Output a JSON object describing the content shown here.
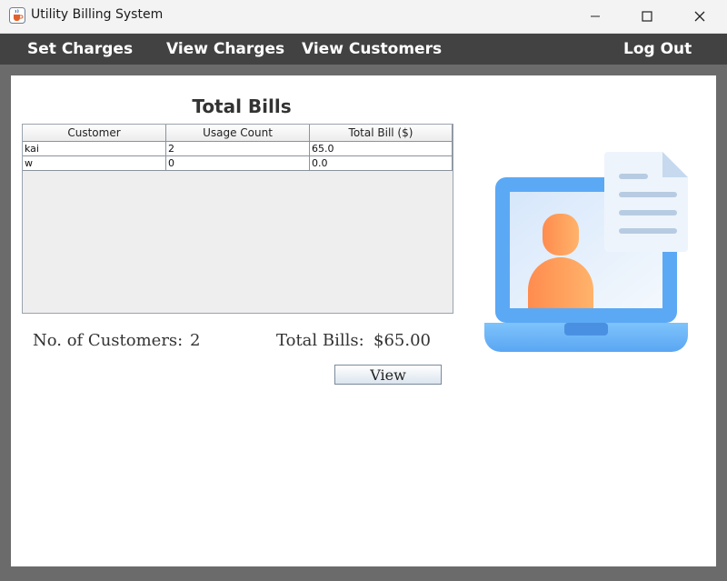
{
  "window": {
    "title": "Utility Billing System",
    "icon": "java-cup-icon",
    "controls": [
      "minimize-icon",
      "maximize-icon",
      "close-icon"
    ]
  },
  "menu": {
    "set_charges": "Set Charges",
    "view_charges": "View Charges",
    "view_customers": "View Customers",
    "log_out": "Log Out"
  },
  "main": {
    "heading": "Total Bills",
    "table": {
      "columns": [
        "Customer",
        "Usage Count",
        "Total Bill ($)"
      ],
      "rows": [
        [
          "kai",
          "2",
          "65.0"
        ],
        [
          "w",
          "0",
          "0.0"
        ]
      ]
    },
    "summary": {
      "customers_label": "No. of Customers:",
      "customers_value": "2",
      "bills_label": "Total Bills:",
      "bills_value": "$65.00"
    },
    "view_button": "View",
    "illustration": "laptop-user-document-illustration"
  },
  "colors": {
    "menubar": "#424242",
    "frame": "#6b6b6b",
    "laptop": "#5aa9f5",
    "person": "#ff9a57"
  }
}
